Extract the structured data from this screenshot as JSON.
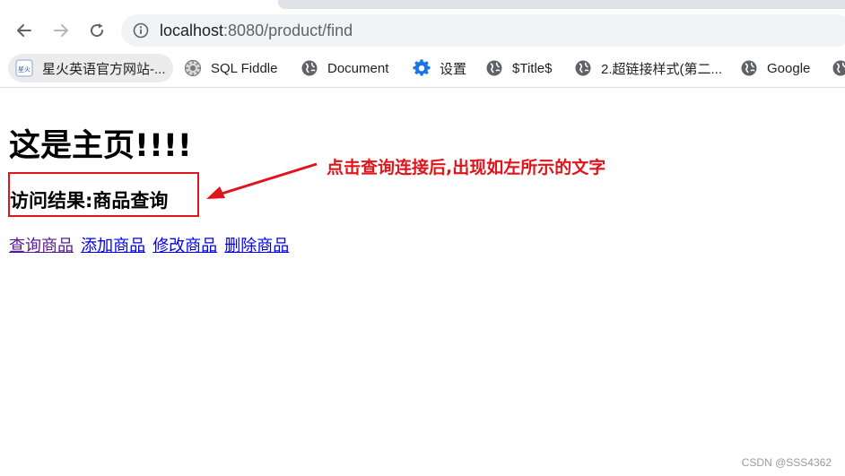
{
  "browser": {
    "url_host": "localhost",
    "url_rest": ":8080/product/find"
  },
  "bookmarks": [
    {
      "label": "星火英语官方网站-...",
      "icon": "xinghuo-favicon"
    },
    {
      "label": "SQL Fiddle",
      "icon": "sql-fiddle-favicon"
    },
    {
      "label": "Document",
      "icon": "globe-icon"
    },
    {
      "label": "设置",
      "icon": "gear-icon"
    },
    {
      "label": "$Title$",
      "icon": "globe-icon"
    },
    {
      "label": "2.超链接样式(第二...",
      "icon": "globe-icon"
    },
    {
      "label": "Google",
      "icon": "globe-icon"
    }
  ],
  "page": {
    "title": "这是主页!!!!",
    "result": "访问结果:商品查询",
    "links": [
      "查询商品",
      "添加商品",
      "修改商品",
      "删除商品"
    ]
  },
  "annotation": {
    "text": "点击查询连接后,出现如左所示的文字",
    "color": "#e0151b"
  },
  "watermark": "CSDN @SSS4362"
}
